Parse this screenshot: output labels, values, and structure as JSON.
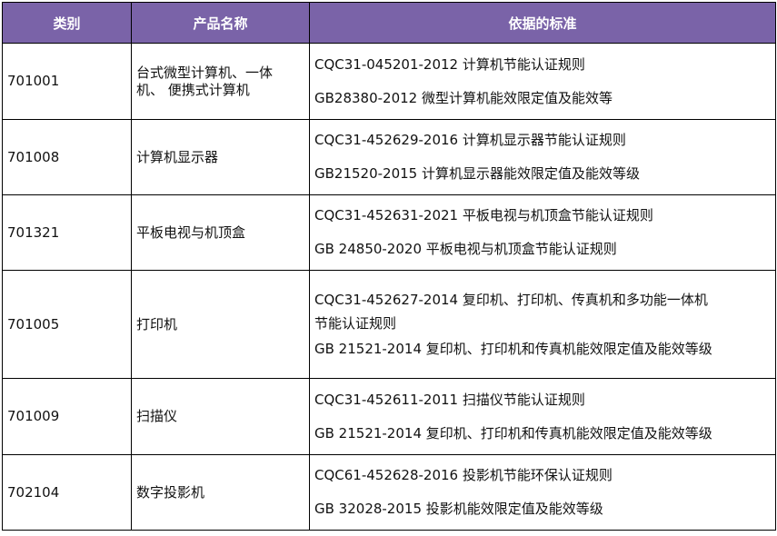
{
  "table": {
    "headers": [
      "类别",
      "产品名称",
      "依据的标准"
    ],
    "rows": [
      {
        "category": "701001",
        "product": [
          "台式微型计算机、一体",
          "机、 便携式计算机"
        ],
        "standards": [
          "CQC31-045201-2012 计算机节能认证规则",
          "GB28380-2012 微型计算机能效限定值及能效等"
        ]
      },
      {
        "category": "701008",
        "product": [
          "计算机显示器"
        ],
        "standards": [
          "CQC31-452629-2016 计算机显示器节能认证规则",
          "GB21520-2015 计算机显示器能效限定值及能效等级"
        ]
      },
      {
        "category": "701321",
        "product": [
          "平板电视与机顶盒"
        ],
        "standards": [
          "CQC31-452631-2021 平板电视与机顶盒节能认证规则",
          "GB 24850-2020 平板电视与机顶盒节能认证规则"
        ]
      },
      {
        "category": "701005",
        "product": [
          "打印机"
        ],
        "standards": [
          "CQC31-452627-2014 复印机、打印机、传真机和多功能一体机",
          "节能认证规则",
          "GB 21521-2014 复印机、打印机和传真机能效限定值及能效等级"
        ]
      },
      {
        "category": "701009",
        "product": [
          "扫描仪"
        ],
        "standards": [
          "CQC31-452611-2011 扫描仪节能认证规则",
          "GB 21521-2014 复印机、打印机和传真机能效限定值及能效等级"
        ]
      },
      {
        "category": "702104",
        "product": [
          "数字投影机"
        ],
        "standards": [
          "CQC61-452628-2016 投影机节能环保认证规则",
          "GB 32028-2015 投影机能效限定值及能效等级"
        ]
      }
    ]
  }
}
